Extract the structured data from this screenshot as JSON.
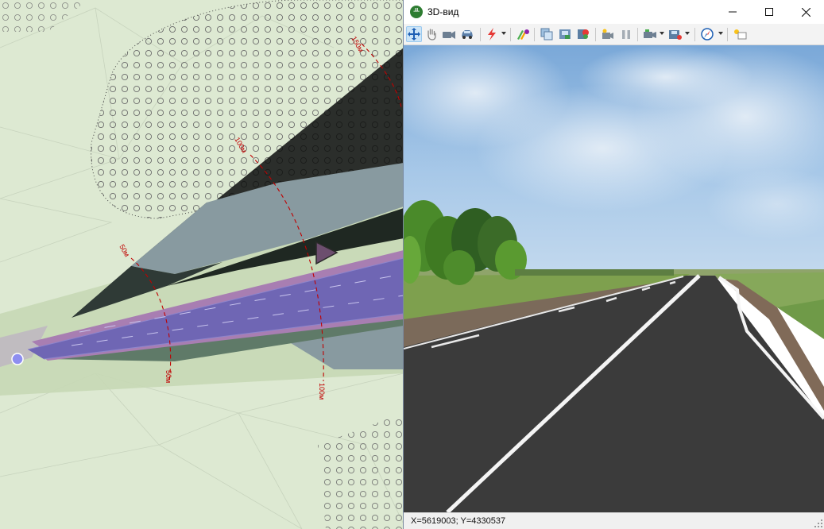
{
  "plan": {
    "stations": [
      {
        "label": "50м"
      },
      {
        "label": "100м"
      },
      {
        "label": "150м"
      },
      {
        "label": "50м"
      },
      {
        "label": "100м"
      }
    ],
    "road_color": "#6f66b4",
    "slope_color": "#2b2e2b"
  },
  "window": {
    "title": "3D-вид",
    "icon_name": "app-3d-logo-icon",
    "controls": {
      "minimize": "minimize-icon",
      "maximize": "maximize-icon",
      "close": "close-icon"
    }
  },
  "toolbar": {
    "buttons": [
      {
        "name": "pan-move-icon",
        "active": true
      },
      {
        "name": "hand-icon"
      },
      {
        "name": "camera-icon"
      },
      {
        "name": "car-icon"
      },
      {
        "name": "lightning-icon",
        "dropdown": true
      },
      {
        "name": "render-mode-icon"
      },
      {
        "name": "copy-image-icon"
      },
      {
        "name": "save-image-icon"
      },
      {
        "name": "export-icon"
      },
      {
        "name": "record-video-icon"
      },
      {
        "name": "pause-icon"
      },
      {
        "name": "camera-view-icon",
        "dropdown": true
      },
      {
        "name": "save-view-icon",
        "dropdown": true
      },
      {
        "name": "compass-icon",
        "dropdown": true
      },
      {
        "name": "light-settings-icon"
      }
    ]
  },
  "status": {
    "coordinates": "X=5619003; Y=4330537"
  }
}
